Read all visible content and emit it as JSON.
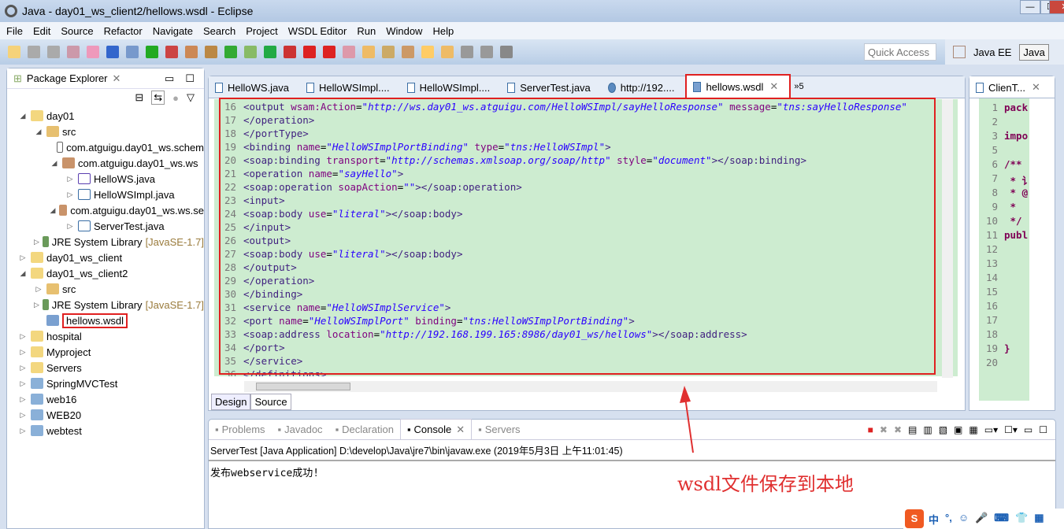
{
  "window": {
    "title": "Java - day01_ws_client2/hellows.wsdl - Eclipse",
    "controls": [
      "—",
      "☐",
      "✕"
    ]
  },
  "menu": [
    "File",
    "Edit",
    "Source",
    "Refactor",
    "Navigate",
    "Search",
    "Project",
    "WSDL Editor",
    "Run",
    "Window",
    "Help"
  ],
  "toolbar": {
    "quick_access_placeholder": "Quick Access",
    "perspectives": [
      "Java EE",
      "Java"
    ]
  },
  "package_explorer": {
    "title": "Package Explorer",
    "items": [
      {
        "level": 0,
        "twisty": "open",
        "icon": "project-folder-icon",
        "label": "day01"
      },
      {
        "level": 1,
        "twisty": "open",
        "icon": "source-folder-icon",
        "label": "src"
      },
      {
        "level": 2,
        "twisty": "none",
        "icon": "empty-package-icon",
        "label": "com.atguigu.day01_ws.schem"
      },
      {
        "level": 2,
        "twisty": "open",
        "icon": "package-icon",
        "label": "com.atguigu.day01_ws.ws"
      },
      {
        "level": 3,
        "twisty": "closed",
        "icon": "java-interface-icon",
        "label": "HelloWS.java"
      },
      {
        "level": 3,
        "twisty": "closed",
        "icon": "java-file-icon",
        "label": "HelloWSImpl.java"
      },
      {
        "level": 2,
        "twisty": "open",
        "icon": "package-icon",
        "label": "com.atguigu.day01_ws.ws.se"
      },
      {
        "level": 3,
        "twisty": "closed",
        "icon": "java-file-icon",
        "label": "ServerTest.java"
      },
      {
        "level": 1,
        "twisty": "closed",
        "icon": "library-icon",
        "label": "JRE System Library",
        "deco": "[JavaSE-1.7]"
      },
      {
        "level": 0,
        "twisty": "closed",
        "icon": "project-folder-icon",
        "label": "day01_ws_client"
      },
      {
        "level": 0,
        "twisty": "open",
        "icon": "project-folder-icon",
        "label": "day01_ws_client2"
      },
      {
        "level": 1,
        "twisty": "closed",
        "icon": "source-folder-icon",
        "label": "src"
      },
      {
        "level": 1,
        "twisty": "closed",
        "icon": "library-icon",
        "label": "JRE System Library",
        "deco": "[JavaSE-1.7]"
      },
      {
        "level": 1,
        "twisty": "none",
        "icon": "wsdl-file-icon",
        "label": "hellows.wsdl",
        "highlighted": true
      },
      {
        "level": 0,
        "twisty": "closed",
        "icon": "project-folder-icon",
        "label": "hospital"
      },
      {
        "level": 0,
        "twisty": "closed",
        "icon": "project-folder-icon",
        "label": "Myproject"
      },
      {
        "level": 0,
        "twisty": "closed",
        "icon": "folder-icon",
        "label": "Servers"
      },
      {
        "level": 0,
        "twisty": "closed",
        "icon": "web-project-icon",
        "label": "SpringMVCTest"
      },
      {
        "level": 0,
        "twisty": "closed",
        "icon": "web-project-icon",
        "label": "web16"
      },
      {
        "level": 0,
        "twisty": "closed",
        "icon": "web-project-icon",
        "label": "WEB20"
      },
      {
        "level": 0,
        "twisty": "closed",
        "icon": "web-project-icon",
        "label": "webtest"
      }
    ]
  },
  "editor": {
    "tabs": [
      {
        "label": "HelloWS.java",
        "icon": "java-file-icon"
      },
      {
        "label": "HelloWSImpl....",
        "icon": "java-file-icon"
      },
      {
        "label": "HelloWSImpl....",
        "icon": "java-file-icon"
      },
      {
        "label": "ServerTest.java",
        "icon": "java-file-icon"
      },
      {
        "label": "http://192....",
        "icon": "globe-icon"
      },
      {
        "label": "hellows.wsdl",
        "icon": "wsdl-file-icon",
        "active": true
      }
    ],
    "overflow": "»5",
    "lines": [
      {
        "n": "16",
        "s": [
          [
            "tag",
            "<output "
          ],
          [
            "att",
            "wsam:Action"
          ],
          [
            "txt",
            "="
          ],
          [
            "val",
            "\"http://ws.day01_ws.atguigu.com/HelloWSImpl/sayHelloResponse\""
          ],
          [
            "txt",
            " "
          ],
          [
            "att",
            "message"
          ],
          [
            "txt",
            "="
          ],
          [
            "val",
            "\"tns:sayHelloResponse\""
          ]
        ]
      },
      {
        "n": "17",
        "s": [
          [
            "tag",
            "</operation>"
          ]
        ]
      },
      {
        "n": "18",
        "s": [
          [
            "tag",
            "</portType>"
          ]
        ]
      },
      {
        "n": "19",
        "s": [
          [
            "tag",
            "<binding "
          ],
          [
            "att",
            "name"
          ],
          [
            "txt",
            "="
          ],
          [
            "val",
            "\"HelloWSImplPortBinding\""
          ],
          [
            "txt",
            " "
          ],
          [
            "att",
            "type"
          ],
          [
            "txt",
            "="
          ],
          [
            "val",
            "\"tns:HelloWSImpl\""
          ],
          [
            "tag",
            ">"
          ]
        ]
      },
      {
        "n": "20",
        "s": [
          [
            "tag",
            "<soap:binding "
          ],
          [
            "att",
            "transport"
          ],
          [
            "txt",
            "="
          ],
          [
            "val",
            "\"http://schemas.xmlsoap.org/soap/http\""
          ],
          [
            "txt",
            " "
          ],
          [
            "att",
            "style"
          ],
          [
            "txt",
            "="
          ],
          [
            "val",
            "\"document\""
          ],
          [
            "tag",
            "></soap:binding>"
          ]
        ]
      },
      {
        "n": "21",
        "s": [
          [
            "tag",
            "<operation "
          ],
          [
            "att",
            "name"
          ],
          [
            "txt",
            "="
          ],
          [
            "val",
            "\"sayHello\""
          ],
          [
            "tag",
            ">"
          ]
        ]
      },
      {
        "n": "22",
        "s": [
          [
            "tag",
            "<soap:operation "
          ],
          [
            "att",
            "soapAction"
          ],
          [
            "txt",
            "="
          ],
          [
            "val",
            "\"\""
          ],
          [
            "tag",
            "></soap:operation>"
          ]
        ]
      },
      {
        "n": "23",
        "s": [
          [
            "tag",
            "<input>"
          ]
        ]
      },
      {
        "n": "24",
        "s": [
          [
            "tag",
            "<soap:body "
          ],
          [
            "att",
            "use"
          ],
          [
            "txt",
            "="
          ],
          [
            "val",
            "\"literal\""
          ],
          [
            "tag",
            "></soap:body>"
          ]
        ]
      },
      {
        "n": "25",
        "s": [
          [
            "tag",
            "</input>"
          ]
        ]
      },
      {
        "n": "26",
        "s": [
          [
            "tag",
            "<output>"
          ]
        ]
      },
      {
        "n": "27",
        "s": [
          [
            "tag",
            "<soap:body "
          ],
          [
            "att",
            "use"
          ],
          [
            "txt",
            "="
          ],
          [
            "val",
            "\"literal\""
          ],
          [
            "tag",
            "></soap:body>"
          ]
        ]
      },
      {
        "n": "28",
        "s": [
          [
            "tag",
            "</output>"
          ]
        ]
      },
      {
        "n": "29",
        "s": [
          [
            "tag",
            "</operation>"
          ]
        ]
      },
      {
        "n": "30",
        "s": [
          [
            "tag",
            "</binding>"
          ]
        ]
      },
      {
        "n": "31",
        "s": [
          [
            "tag",
            "<service "
          ],
          [
            "att",
            "name"
          ],
          [
            "txt",
            "="
          ],
          [
            "val",
            "\"HelloWSImplService\""
          ],
          [
            "tag",
            ">"
          ]
        ]
      },
      {
        "n": "32",
        "s": [
          [
            "tag",
            "<port "
          ],
          [
            "att",
            "name"
          ],
          [
            "txt",
            "="
          ],
          [
            "val",
            "\"HelloWSImplPort\""
          ],
          [
            "txt",
            " "
          ],
          [
            "att",
            "binding"
          ],
          [
            "txt",
            "="
          ],
          [
            "val",
            "\"tns:HelloWSImplPortBinding\""
          ],
          [
            "tag",
            ">"
          ]
        ]
      },
      {
        "n": "33",
        "s": [
          [
            "tag",
            "<soap:address "
          ],
          [
            "att",
            "location"
          ],
          [
            "txt",
            "="
          ],
          [
            "val",
            "\"http://192.168.199.165:8986/day01_ws/hellows\""
          ],
          [
            "tag",
            "></soap:address>"
          ]
        ]
      },
      {
        "n": "34",
        "s": [
          [
            "tag",
            "</port>"
          ]
        ]
      },
      {
        "n": "35",
        "s": [
          [
            "tag",
            "</service>"
          ]
        ]
      },
      {
        "n": "36",
        "s": [
          [
            "tag",
            "</definitions>"
          ]
        ]
      }
    ],
    "bottom_tabs": [
      "Design",
      "Source"
    ],
    "active_bottom_tab": "Source"
  },
  "client_editor": {
    "tab": "ClienT...",
    "lines": [
      [
        "1",
        "pack"
      ],
      [
        "2",
        ""
      ],
      [
        "3",
        "impo"
      ],
      [
        "5",
        ""
      ],
      [
        "6",
        "/**"
      ],
      [
        "7",
        " * 讠"
      ],
      [
        "8",
        " * @"
      ],
      [
        "9",
        " *"
      ],
      [
        "10",
        " */"
      ],
      [
        "11",
        "publ"
      ],
      [
        "12",
        ""
      ],
      [
        "13",
        ""
      ],
      [
        "14",
        ""
      ],
      [
        "15",
        ""
      ],
      [
        "16",
        ""
      ],
      [
        "17",
        ""
      ],
      [
        "18",
        ""
      ],
      [
        "19",
        "}"
      ],
      [
        "20",
        ""
      ]
    ]
  },
  "console": {
    "tabs": [
      "Problems",
      "Javadoc",
      "Declaration",
      "Console",
      "Servers"
    ],
    "active": "Console",
    "header": "ServerTest [Java Application] D:\\develop\\Java\\jre7\\bin\\javaw.exe (2019年5月3日 上午11:01:45)",
    "output": "发布webservice成功!"
  },
  "annotation": "wsdl文件保存到本地",
  "ime": {
    "items": [
      "中",
      "°,",
      "☺",
      "🎤",
      "⌨",
      "👕",
      "▦"
    ]
  },
  "colors": {
    "editor_bg": "#cdecd0",
    "highlight": "#e02020",
    "annotation": "#e03030"
  }
}
